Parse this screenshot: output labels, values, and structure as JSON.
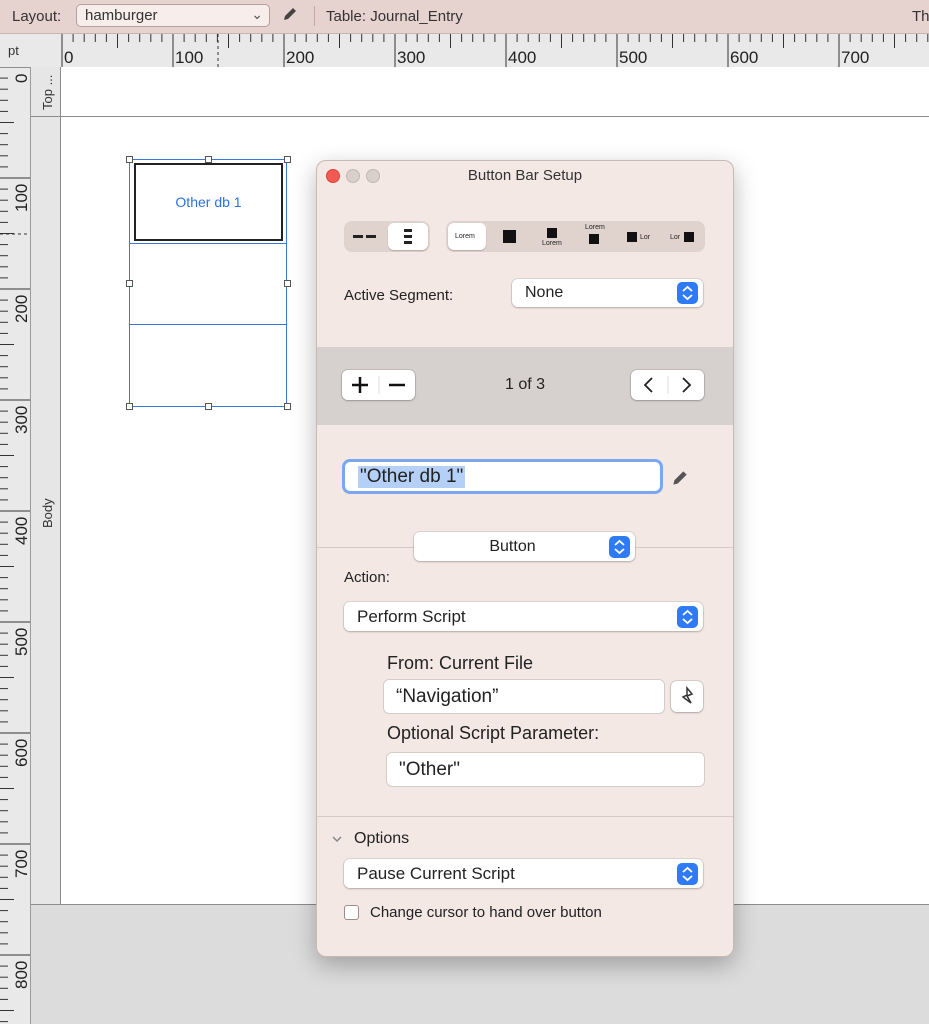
{
  "toolbar": {
    "layout_label": "Layout:",
    "layout_value": "hamburger",
    "table_label": "Table: Journal_Entry",
    "right_clip": "Th"
  },
  "ruler": {
    "unit": "pt",
    "h_labels": [
      "0",
      "100",
      "200",
      "300",
      "400",
      "500",
      "600",
      "700"
    ],
    "v_labels": [
      "0",
      "100",
      "200",
      "300",
      "400",
      "500",
      "600",
      "700",
      "800"
    ]
  },
  "parts": {
    "top": "Top ...",
    "body": "Body"
  },
  "button_bar": {
    "segment1_label": "Other db 1"
  },
  "dialog": {
    "title": "Button Bar Setup",
    "style_samples": {
      "lorem": "Lorem",
      "lor": "Lor"
    },
    "active_segment_label": "Active Segment:",
    "active_segment_value": "None",
    "pager": "1 of 3",
    "segment_text": "\"Other db 1\"",
    "type_value": "Button",
    "action_label": "Action:",
    "action_value": "Perform Script",
    "from_label": "From: Current File",
    "script_name": "“Navigation”",
    "param_label": "Optional Script Parameter:",
    "param_value": "\"Other\"",
    "options_label": "Options",
    "options_value": "Pause Current Script",
    "cursor_checkbox_label": "Change cursor to hand over button",
    "cursor_checkbox_checked": false
  },
  "colors": {
    "toolbar_bg": "#e6d2cf",
    "dialog_bg": "#f3e8e3",
    "accent": "#2f7bf5",
    "selection": "#3a78e0"
  }
}
